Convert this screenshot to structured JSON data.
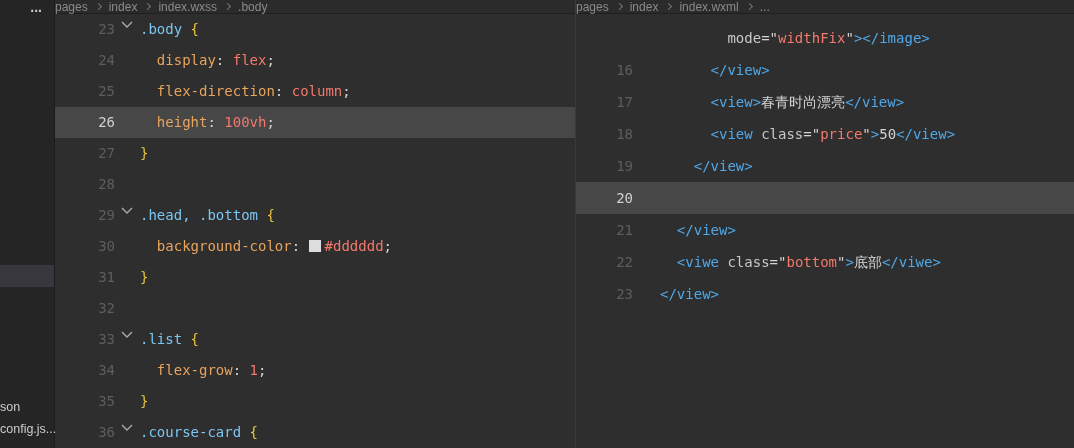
{
  "sidebar": {
    "menu": "...",
    "items": [
      {
        "label": "son",
        "selected": false
      },
      {
        "label": "config.js...",
        "selected": false
      }
    ]
  },
  "left_editor": {
    "breadcrumb": [
      "pages",
      "index",
      "index.wxss",
      ".body"
    ],
    "lines": [
      {
        "number": "23",
        "fold": true,
        "current": false,
        "tokens": [
          {
            "kind": "selector",
            "text": ".body"
          },
          {
            "kind": "brace",
            "text": "{"
          }
        ]
      },
      {
        "number": "24",
        "fold": false,
        "current": false,
        "tokens": [
          {
            "kind": "property",
            "text": "  display"
          },
          {
            "kind": "punct",
            "text": ":"
          },
          {
            "kind": "value",
            "text": "flex"
          },
          {
            "kind": "punct",
            "text": ";"
          }
        ]
      },
      {
        "number": "25",
        "fold": false,
        "current": false,
        "tokens": [
          {
            "kind": "property",
            "text": "  flex-direction"
          },
          {
            "kind": "punct",
            "text": ":"
          },
          {
            "kind": "value",
            "text": "column"
          },
          {
            "kind": "punct",
            "text": ";"
          }
        ]
      },
      {
        "number": "26",
        "fold": false,
        "current": true,
        "tokens": [
          {
            "kind": "property",
            "text": "  height"
          },
          {
            "kind": "punct",
            "text": ":"
          },
          {
            "kind": "value",
            "text": "100vh"
          },
          {
            "kind": "punct",
            "text": ";"
          }
        ]
      },
      {
        "number": "27",
        "fold": false,
        "current": false,
        "tokens": [
          {
            "kind": "brace",
            "text": "}"
          }
        ]
      },
      {
        "number": "28",
        "fold": false,
        "current": false
      },
      {
        "number": "29",
        "fold": true,
        "current": false,
        "tokens": [
          {
            "kind": "selector",
            "text": ".head, .bottom"
          },
          {
            "kind": "brace",
            "text": "{"
          }
        ]
      },
      {
        "number": "30",
        "fold": false,
        "current": false,
        "tokens": [
          {
            "kind": "property",
            "text": "  background-color"
          },
          {
            "kind": "punct",
            "text": ":"
          },
          {
            "kind": "swatch",
            "color": "#dddddd"
          },
          {
            "kind": "value",
            "text": "#dddddd"
          },
          {
            "kind": "punct",
            "text": ";"
          }
        ]
      },
      {
        "number": "31",
        "fold": false,
        "current": false,
        "tokens": [
          {
            "kind": "brace",
            "text": "}"
          }
        ]
      },
      {
        "number": "32",
        "fold": false,
        "current": false
      },
      {
        "number": "33",
        "fold": true,
        "current": false,
        "tokens": [
          {
            "kind": "selector",
            "text": ".list"
          },
          {
            "kind": "brace",
            "text": "{"
          }
        ]
      },
      {
        "number": "34",
        "fold": false,
        "current": false,
        "tokens": [
          {
            "kind": "property",
            "text": "  flex-grow"
          },
          {
            "kind": "punct",
            "text": ":"
          },
          {
            "kind": "value",
            "text": "1"
          },
          {
            "kind": "punct",
            "text": ";"
          }
        ]
      },
      {
        "number": "35",
        "fold": false,
        "current": false,
        "tokens": [
          {
            "kind": "brace",
            "text": "}"
          }
        ]
      },
      {
        "number": "36",
        "fold": true,
        "current": false,
        "tokens": [
          {
            "kind": "selector",
            "text": ".course-card"
          },
          {
            "kind": "brace",
            "text": "{"
          }
        ]
      }
    ]
  },
  "right_editor": {
    "breadcrumb": [
      "pages",
      "index",
      "index.wxml",
      "..."
    ],
    "lines": [
      {
        "current": false,
        "tokens": [
          {
            "kind": "attr",
            "text": "        mode"
          },
          {
            "kind": "punct",
            "text": "=\""
          },
          {
            "kind": "string",
            "text": "widthFix"
          },
          {
            "kind": "punct",
            "text": "\""
          },
          {
            "kind": "tag",
            "text": "></image>"
          }
        ]
      },
      {
        "number": "16",
        "current": false,
        "tokens": [
          {
            "kind": "tag",
            "text": "      </view>"
          }
        ]
      },
      {
        "number": "17",
        "current": false,
        "tokens": [
          {
            "kind": "tag",
            "text": "      <view>"
          },
          {
            "kind": "text",
            "text": "春青时尚漂亮"
          },
          {
            "kind": "tag",
            "text": "</view>"
          }
        ]
      },
      {
        "number": "18",
        "current": false,
        "tokens": [
          {
            "kind": "tag",
            "text": "      <view "
          },
          {
            "kind": "attr",
            "text": "class"
          },
          {
            "kind": "punct",
            "text": "=\""
          },
          {
            "kind": "string",
            "text": "price"
          },
          {
            "kind": "punct",
            "text": "\""
          },
          {
            "kind": "tag",
            "text": ">"
          },
          {
            "kind": "text",
            "text": "50"
          },
          {
            "kind": "tag",
            "text": "</view>"
          }
        ]
      },
      {
        "number": "19",
        "current": false,
        "tokens": [
          {
            "kind": "tag",
            "text": "    </view>"
          }
        ]
      },
      {
        "number": "20",
        "current": true
      },
      {
        "number": "21",
        "current": false,
        "tokens": [
          {
            "kind": "tag",
            "text": "  </view>"
          }
        ]
      },
      {
        "number": "22",
        "current": false,
        "tokens": [
          {
            "kind": "tag",
            "text": "  <viwe "
          },
          {
            "kind": "attr",
            "text": "class"
          },
          {
            "kind": "punct",
            "text": "=\""
          },
          {
            "kind": "string",
            "text": "bottom"
          },
          {
            "kind": "punct",
            "text": "\""
          },
          {
            "kind": "tag",
            "text": ">"
          },
          {
            "kind": "text",
            "text": "底部"
          },
          {
            "kind": "tag",
            "text": "</viwe>"
          }
        ]
      },
      {
        "number": "23",
        "current": false,
        "tokens": [
          {
            "kind": "tag",
            "text": "</view>"
          }
        ]
      }
    ]
  }
}
